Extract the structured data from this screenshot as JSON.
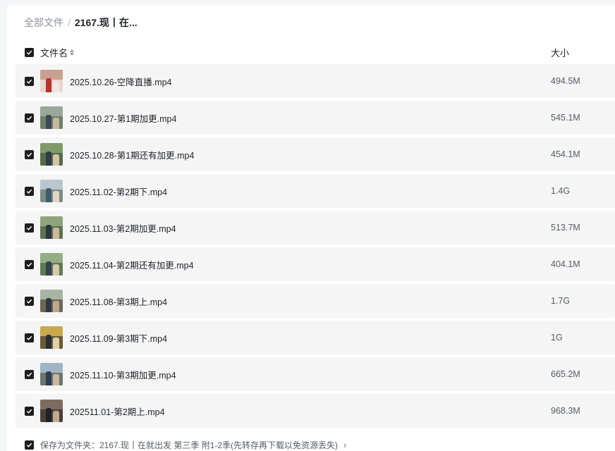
{
  "breadcrumb": {
    "root": "全部文件",
    "separator": "/",
    "current": "2167.现丨在..."
  },
  "header": {
    "name_label": "文件名",
    "size_label": "大小",
    "all_checked": true
  },
  "files": [
    {
      "name": "2025.10.26-空降直播.mp4",
      "size": "494.5M",
      "checked": true,
      "thumb": {
        "sky": "#c9a08f",
        "ground": "#e9d6cf",
        "fig": "#b8322e",
        "fig2": "#f0e6e4"
      }
    },
    {
      "name": "2025.10.27-第1期加更.mp4",
      "size": "545.1M",
      "checked": true,
      "thumb": {
        "sky": "#9aa89a",
        "ground": "#6f7f6e",
        "fig": "#3d4a52",
        "fig2": "#c8b79a"
      }
    },
    {
      "name": "2025.10.28-第1期还有加更.mp4",
      "size": "454.1M",
      "checked": true,
      "thumb": {
        "sky": "#7f9a6a",
        "ground": "#546b48",
        "fig": "#2f3b45",
        "fig2": "#d5c2a5"
      }
    },
    {
      "name": "2025.11.02-第2期下.mp4",
      "size": "1.4G",
      "checked": true,
      "thumb": {
        "sky": "#b9c6cf",
        "ground": "#7d8c85",
        "fig": "#3f5a6b",
        "fig2": "#e2d4c2"
      }
    },
    {
      "name": "2025.11.03-第2期加更.mp4",
      "size": "513.7M",
      "checked": true,
      "thumb": {
        "sky": "#8fa37d",
        "ground": "#5d7350",
        "fig": "#2b3640",
        "fig2": "#cdb998"
      }
    },
    {
      "name": "2025.11.04-第2期还有加更.mp4",
      "size": "404.1M",
      "checked": true,
      "thumb": {
        "sky": "#94ad83",
        "ground": "#5f7a52",
        "fig": "#34424f",
        "fig2": "#d8c7aa"
      }
    },
    {
      "name": "2025.11.08-第3期上.mp4",
      "size": "1.7G",
      "checked": true,
      "thumb": {
        "sky": "#a7b4a4",
        "ground": "#6e6756",
        "fig": "#2e3942",
        "fig2": "#bfa98a"
      }
    },
    {
      "name": "2025.11.09-第3期下.mp4",
      "size": "1G",
      "checked": true,
      "thumb": {
        "sky": "#c9a94c",
        "ground": "#6b5a36",
        "fig": "#2a2e33",
        "fig2": "#e0cfa8"
      }
    },
    {
      "name": "2025.11.10-第3期加更.mp4",
      "size": "665.2M",
      "checked": true,
      "thumb": {
        "sky": "#9fb4c4",
        "ground": "#6d7670",
        "fig": "#2f3d4d",
        "fig2": "#cbb89a"
      }
    },
    {
      "name": "202511.01-第2期上.mp4",
      "size": "968.3M",
      "checked": true,
      "thumb": {
        "sky": "#7d6d5f",
        "ground": "#4a4038",
        "fig": "#1f2226",
        "fig2": "#c2ab8c"
      }
    }
  ],
  "footer": {
    "save_text": "保存为文件夹：2167.现丨在就出发 第三季 附1-2季(先转存再下载以免资源丢失)",
    "checked": true
  }
}
